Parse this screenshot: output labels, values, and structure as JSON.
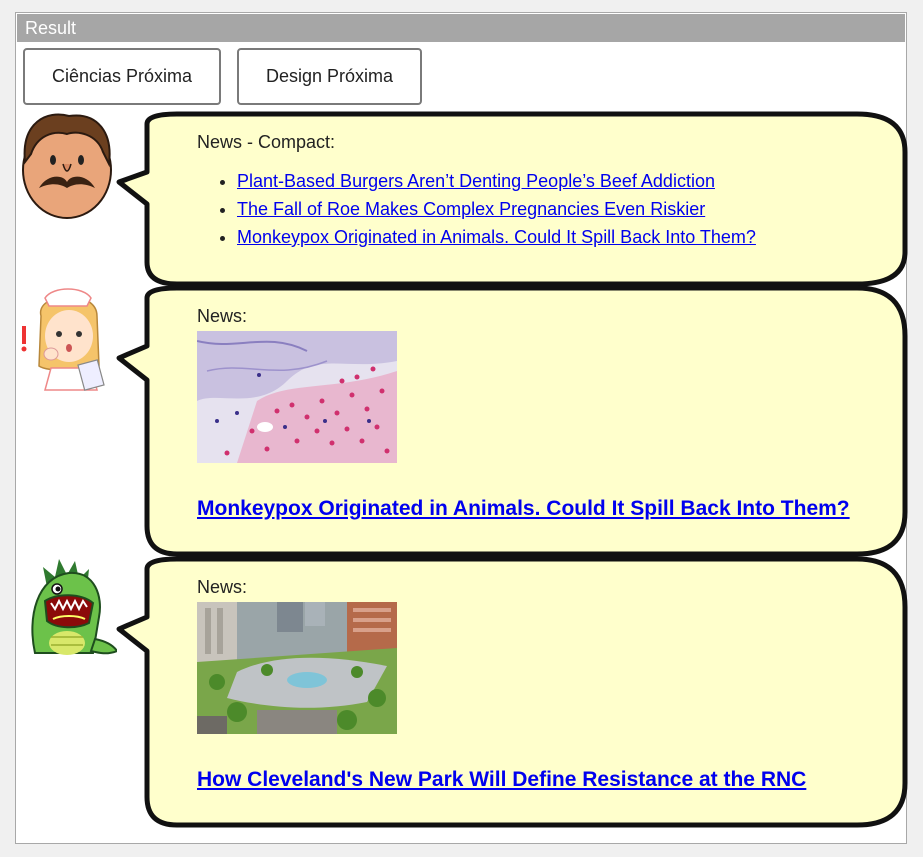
{
  "panel": {
    "title": "Result"
  },
  "nav": {
    "prev_label": "Ciências Próxima",
    "next_label": "Design Próxima"
  },
  "messages": [
    {
      "avatar": "mustache-man-icon",
      "label": "News - Compact:",
      "links": [
        "Plant-Based Burgers Aren’t Denting People’s Beef Addiction",
        "The Fall of Roe Makes Complex Pregnancies Even Riskier",
        "Monkeypox Originated in Animals. Could It Spill Back Into Them?"
      ]
    },
    {
      "avatar": "nurse-girl-icon",
      "label": "News:",
      "image": "microscope-cells-image",
      "headline": "Monkeypox Originated in Animals. Could It Spill Back Into Them?"
    },
    {
      "avatar": "green-dinosaur-icon",
      "label": "News:",
      "image": "city-park-aerial-image",
      "headline": "How Cleveland's New Park Will Define Resistance at the RNC"
    }
  ],
  "colors": {
    "bubble_fill": "#ffffcc",
    "bubble_stroke": "#111111",
    "title_bar": "#a6a6a6",
    "link": "#0000ee"
  }
}
